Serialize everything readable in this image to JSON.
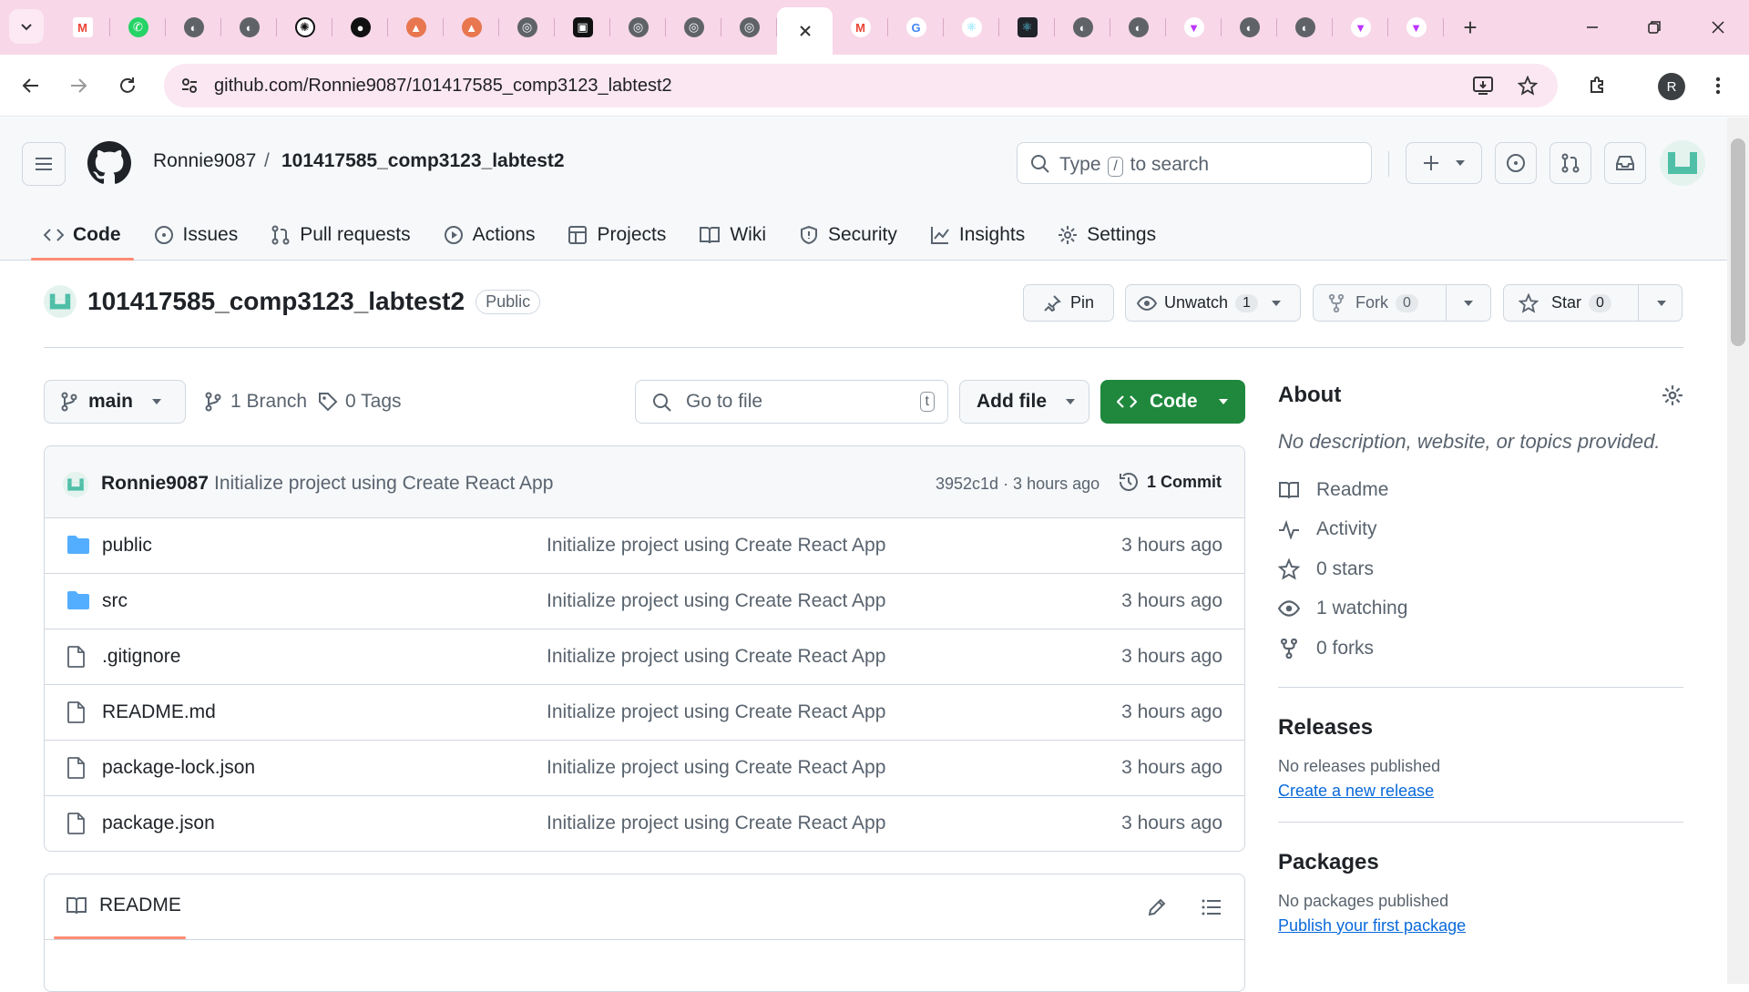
{
  "browser": {
    "url": "github.com/Ronnie9087/101417585_comp3123_labtest2",
    "profile_initial": "R",
    "new_tab_label": "+"
  },
  "header": {
    "owner": "Ronnie9087",
    "separator": "/",
    "repo": "101417585_comp3123_labtest2",
    "search_prefix": "Type",
    "search_key": "/",
    "search_suffix": "to search"
  },
  "nav": [
    {
      "label": "Code"
    },
    {
      "label": "Issues"
    },
    {
      "label": "Pull requests"
    },
    {
      "label": "Actions"
    },
    {
      "label": "Projects"
    },
    {
      "label": "Wiki"
    },
    {
      "label": "Security"
    },
    {
      "label": "Insights"
    },
    {
      "label": "Settings"
    }
  ],
  "repo": {
    "name": "101417585_comp3123_labtest2",
    "visibility": "Public",
    "pin_label": "Pin",
    "unwatch_label": "Unwatch",
    "watch_count": "1",
    "fork_label": "Fork",
    "fork_count": "0",
    "star_label": "Star",
    "star_count": "0"
  },
  "toolbar": {
    "branch": "main",
    "branches": "1 Branch",
    "tags": "0 Tags",
    "goto_placeholder": "Go to file",
    "goto_key": "t",
    "add_file": "Add file",
    "code": "Code"
  },
  "commit": {
    "author": "Ronnie9087",
    "message": "Initialize project using Create React App",
    "hash_time": "3952c1d · 3 hours ago",
    "commits": "1 Commit"
  },
  "files": [
    {
      "name": "public",
      "type": "folder",
      "message": "Initialize project using Create React App",
      "time": "3 hours ago"
    },
    {
      "name": "src",
      "type": "folder",
      "message": "Initialize project using Create React App",
      "time": "3 hours ago"
    },
    {
      "name": ".gitignore",
      "type": "file",
      "message": "Initialize project using Create React App",
      "time": "3 hours ago"
    },
    {
      "name": "README.md",
      "type": "file",
      "message": "Initialize project using Create React App",
      "time": "3 hours ago"
    },
    {
      "name": "package-lock.json",
      "type": "file",
      "message": "Initialize project using Create React App",
      "time": "3 hours ago"
    },
    {
      "name": "package.json",
      "type": "file",
      "message": "Initialize project using Create React App",
      "time": "3 hours ago"
    }
  ],
  "readme": {
    "label": "README"
  },
  "about": {
    "title": "About",
    "description": "No description, website, or topics provided.",
    "items": [
      {
        "label": "Readme"
      },
      {
        "label": "Activity"
      },
      {
        "label": "0 stars"
      },
      {
        "label": "1 watching"
      },
      {
        "label": "0 forks"
      }
    ]
  },
  "releases": {
    "title": "Releases",
    "empty": "No releases published",
    "link": "Create a new release"
  },
  "packages": {
    "title": "Packages",
    "empty": "No packages published",
    "link": "Publish your first package"
  },
  "colors": {
    "accent_green": "#1f883d",
    "nav_underline": "#fd8c73",
    "link_blue": "#0969da",
    "folder_blue": "#54aeff",
    "tabstrip_pink": "#f8d7e8"
  }
}
